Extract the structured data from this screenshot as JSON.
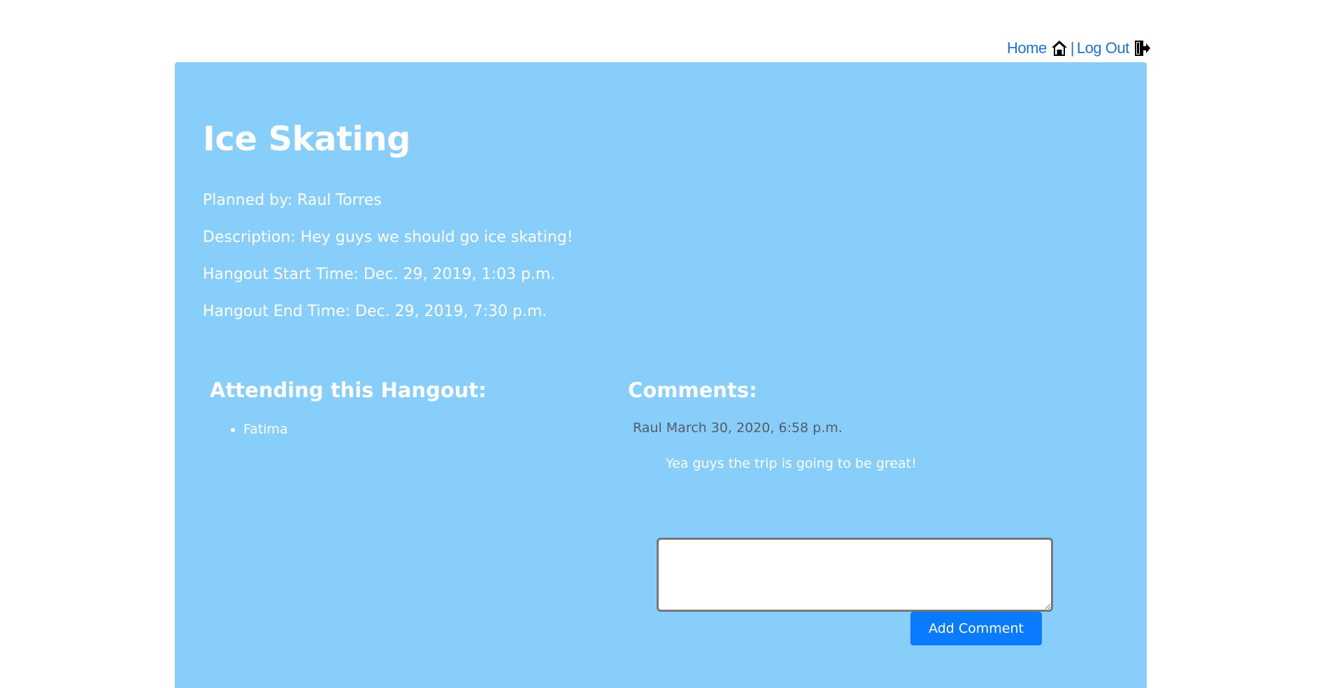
{
  "nav": {
    "home_label": "Home",
    "home_icon": "house-icon",
    "separator": "|",
    "logout_label": "Log Out",
    "logout_icon": "door-exit-icon"
  },
  "hangout": {
    "title": "Ice Skating",
    "planned_by": "Planned by: Raul Torres",
    "description": "Description: Hey guys we should go ice skating!",
    "start_time": "Hangout Start Time: Dec. 29, 2019, 1:03 p.m.",
    "end_time": "Hangout End Time: Dec. 29, 2019, 7:30 p.m."
  },
  "attending": {
    "heading": "Attending this Hangout:",
    "people": [
      "Fatima"
    ]
  },
  "comments": {
    "heading": "Comments:",
    "items": [
      {
        "meta": "Raul March 30, 2020, 6:58 p.m.",
        "text": "Yea guys the trip is going to be great!"
      }
    ],
    "input_value": "",
    "submit_label": "Add Comment"
  },
  "colors": {
    "panel_bg": "#87cefa",
    "link": "#1a73d9",
    "button": "#0a7bff"
  }
}
